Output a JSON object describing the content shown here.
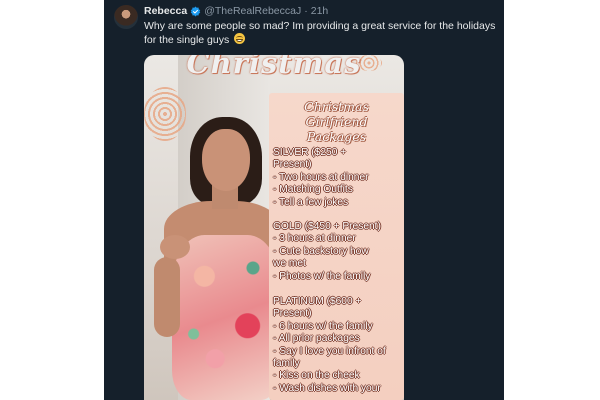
{
  "tweet": {
    "display_name": "Rebecca",
    "handle": "@TheRealRebeccaJ",
    "separator": "·",
    "timestamp": "21h",
    "text": "Why are some people so mad? Im providing a great service for the holidays for the single guys",
    "emoji_icon": "grinning-face-emoji",
    "verified_icon": "verified-badge-icon",
    "verified_color": "#1d9bf0"
  },
  "media": {
    "christmas_title": "Christmas",
    "card_title_line1": "Christmas Girlfriend",
    "card_title_line2": "Packages",
    "packages": {
      "silver": {
        "header": "SILVER ($250 +",
        "header2": "Present)",
        "items": [
          "- Two hours at dinner",
          "- Matching Outfits",
          "- Tell a few jokes"
        ]
      },
      "gold": {
        "header": "GOLD ($450 + Present)",
        "items": [
          "- 3 hours at dinner",
          "- Cute backstory how",
          "we met",
          "- Photos w/ the family"
        ]
      },
      "platinum": {
        "header": "PLATINUM ($600 +",
        "header2": "Present)",
        "items": [
          "- 6 hours w/ the family",
          "- All prior packages",
          "- Say I love you infront of",
          "family",
          "- Kiss on the cheek",
          "- Wash dishes with your"
        ]
      }
    }
  },
  "colors": {
    "tweet_bg": "#15202b",
    "text_primary": "#e7e9ea",
    "text_secondary": "#8b98a5",
    "card_bg": "#f6d8cb"
  }
}
